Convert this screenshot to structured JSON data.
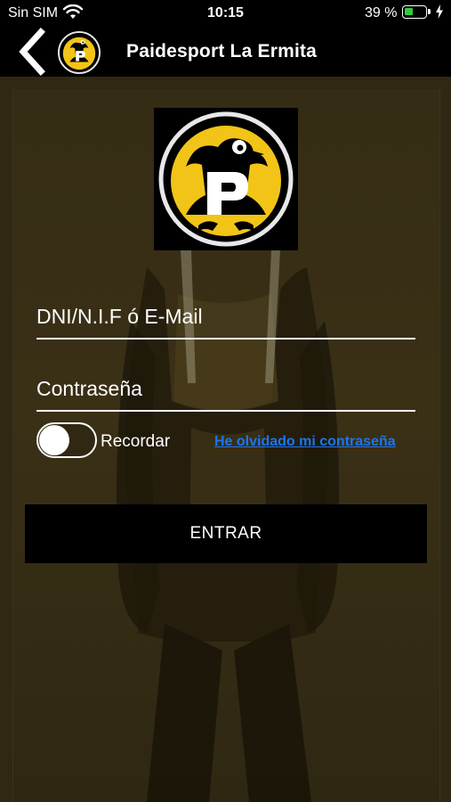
{
  "status_bar": {
    "carrier": "Sin SIM",
    "time": "10:15",
    "battery_percent": "39 %",
    "battery_level": 0.39,
    "icons": [
      "wifi-icon",
      "battery-icon",
      "charging-bolt-icon"
    ]
  },
  "nav": {
    "title": "Paidesport La Ermita",
    "back_icon": "chevron-left-icon",
    "logo": "paidesport-logo"
  },
  "form": {
    "user_placeholder": "DNI/N.I.F ó E-Mail",
    "user_value": "",
    "password_placeholder": "Contraseña",
    "password_value": "",
    "remember_label": "Recordar",
    "remember_on": false,
    "forgot_label": "He olvidado mi contraseña",
    "submit_label": "ENTRAR"
  },
  "colors": {
    "background": "#000000",
    "overlay_tint": "#3a3016",
    "logo_yellow": "#f2c417",
    "link": "#1b76f0"
  }
}
